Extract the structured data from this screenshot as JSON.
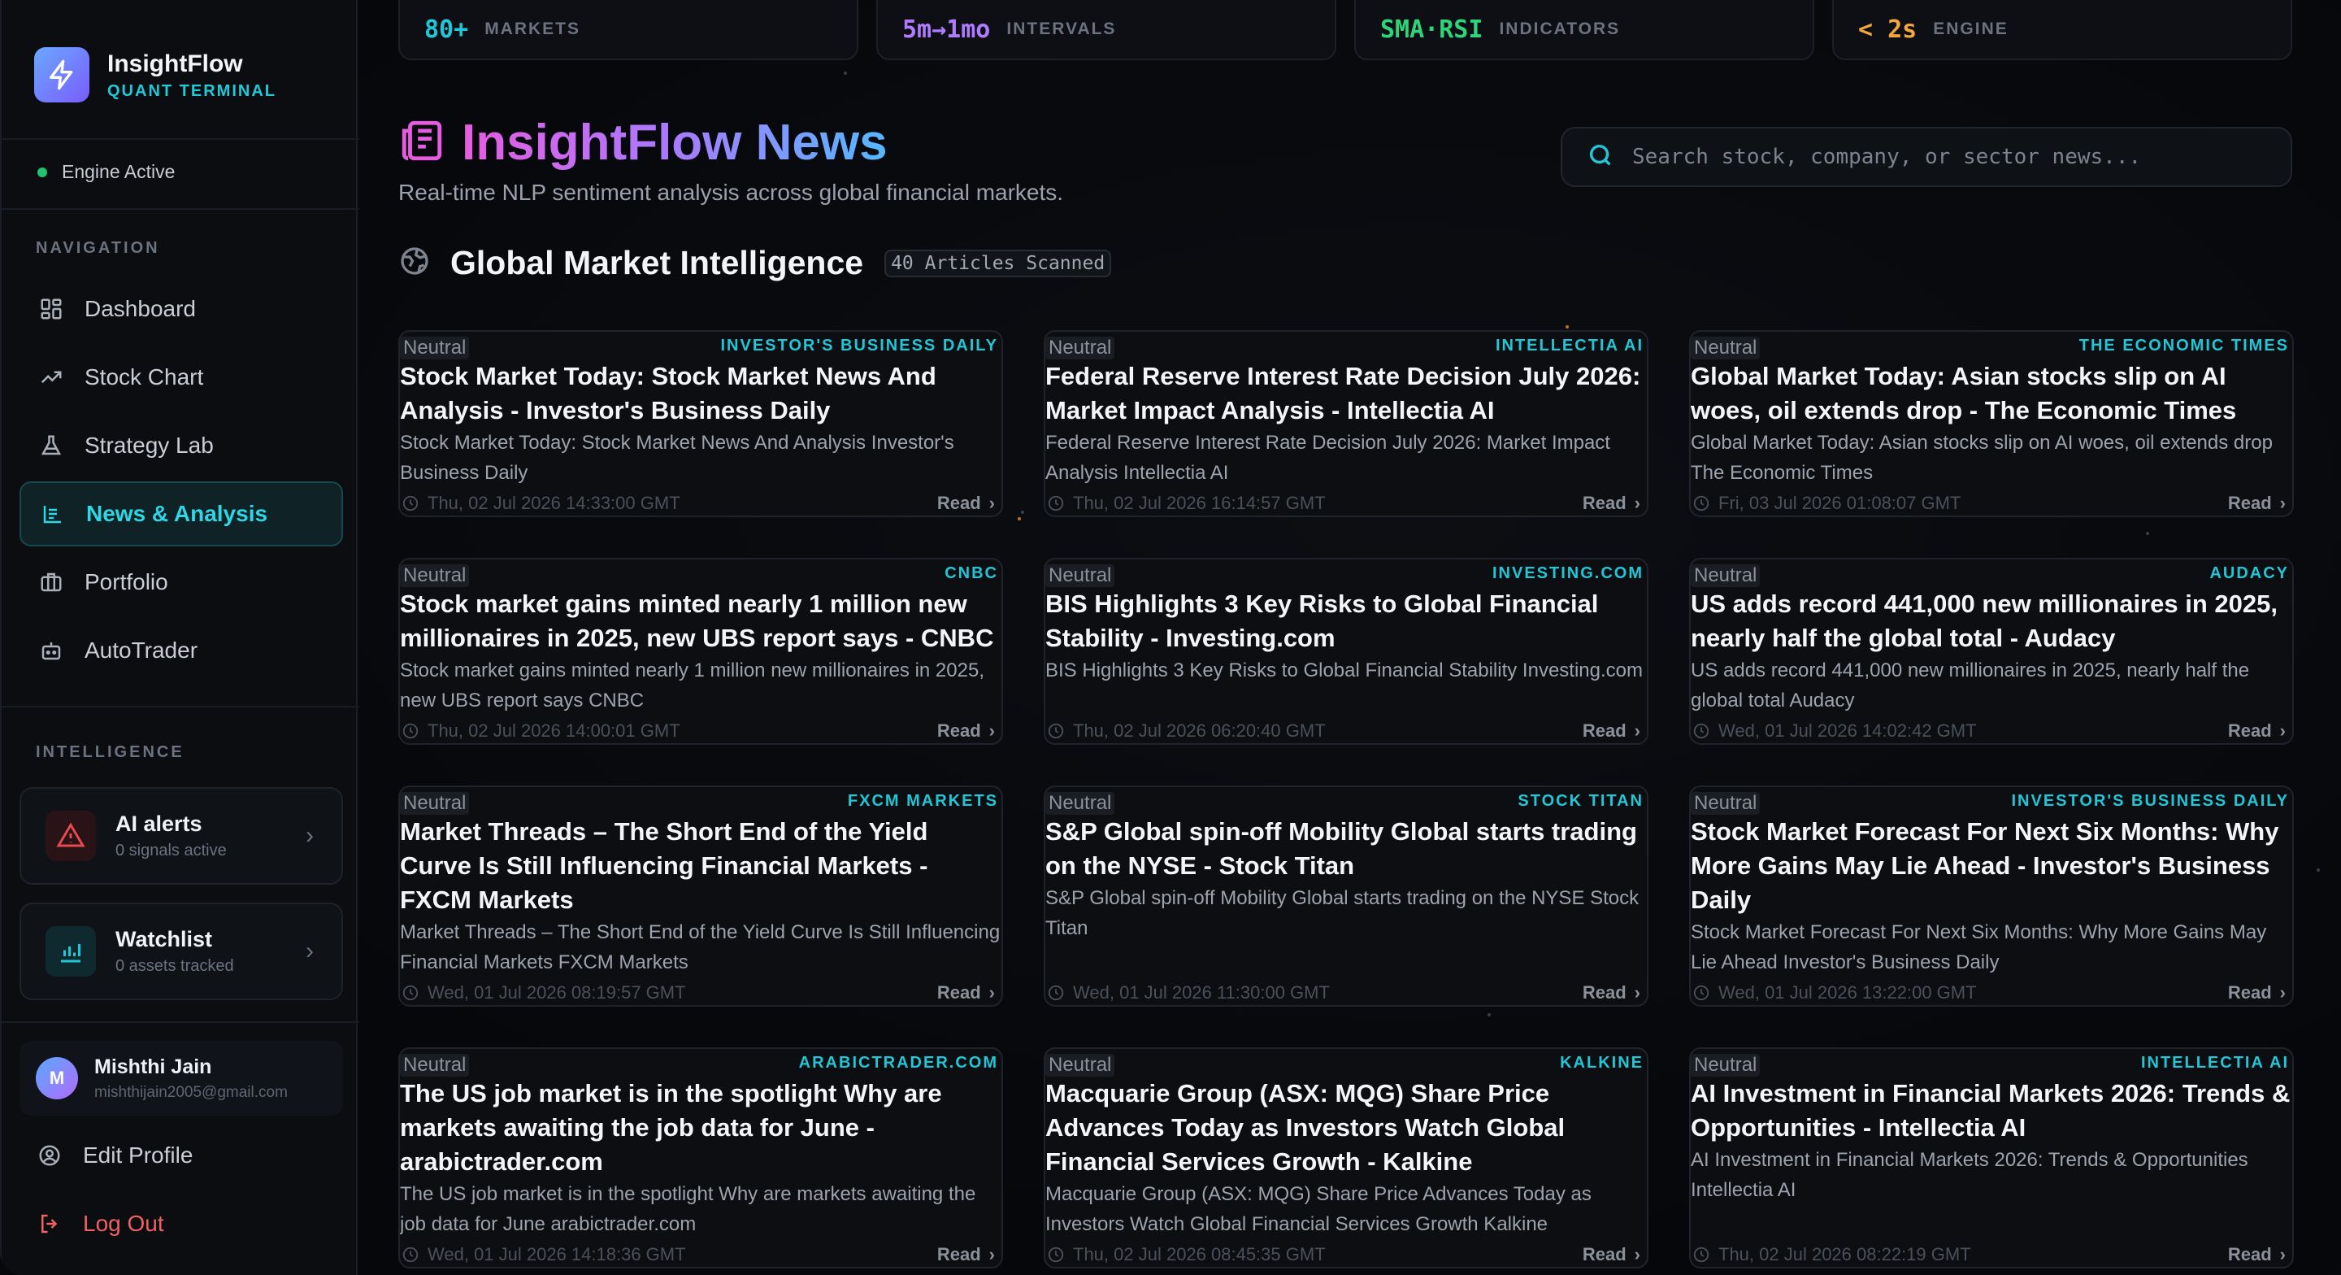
{
  "brand": {
    "name": "InsightFlow",
    "subtitle": "QUANT TERMINAL"
  },
  "engine_status": "Engine Active",
  "nav_label": "NAVIGATION",
  "nav": [
    {
      "label": "Dashboard",
      "icon": "grid-icon"
    },
    {
      "label": "Stock Chart",
      "icon": "trend-up-icon"
    },
    {
      "label": "Strategy Lab",
      "icon": "flask-icon"
    },
    {
      "label": "News & Analysis",
      "icon": "globe-news-icon",
      "active": true
    },
    {
      "label": "Portfolio",
      "icon": "briefcase-icon"
    },
    {
      "label": "AutoTrader",
      "icon": "robot-icon"
    }
  ],
  "intel_label": "INTELLIGENCE",
  "intel": [
    {
      "title": "AI alerts",
      "sub": "0 signals active",
      "icon": "alert-triangle-icon",
      "color": "#e5484d"
    },
    {
      "title": "Watchlist",
      "sub": "0 assets tracked",
      "icon": "bar-chart-icon",
      "color": "#21c7d6"
    }
  ],
  "user": {
    "initial": "M",
    "name": "Mishthi Jain",
    "email": "mishthijain2005@gmail.com"
  },
  "edit_profile": "Edit Profile",
  "log_out": "Log Out",
  "stats": [
    {
      "value": "80+",
      "label": "MARKETS",
      "color": "#21c7d6"
    },
    {
      "value": "5m→1mo",
      "label": "INTERVALS",
      "color": "#b07cff"
    },
    {
      "value": "SMA·RSI",
      "label": "INDICATORS",
      "color": "#2fd37a"
    },
    {
      "value": "< 2s",
      "label": "ENGINE",
      "color": "#f3a63a"
    }
  ],
  "page": {
    "title": "InsightFlow News",
    "subtitle": "Real-time NLP sentiment analysis across global financial markets."
  },
  "search": {
    "placeholder": "Search stock, company, or sector news..."
  },
  "section": {
    "title": "Global Market Intelligence",
    "badge": "40 Articles Scanned"
  },
  "read_label": "Read",
  "articles": [
    {
      "sentiment": "Neutral",
      "source": "INVESTOR'S BUSINESS DAILY",
      "title": "Stock Market Today: Stock Market News And Analysis - Investor's Business Daily",
      "desc": "Stock Market Today: Stock Market News And Analysis Investor's Business Daily",
      "date": "Thu, 02 Jul 2026 14:33:00 GMT"
    },
    {
      "sentiment": "Neutral",
      "source": "INTELLECTIA AI",
      "title": "Federal Reserve Interest Rate Decision July 2026: Market Impact Analysis - Intellectia AI",
      "desc": "Federal Reserve Interest Rate Decision July 2026: Market Impact Analysis Intellectia AI",
      "date": "Thu, 02 Jul 2026 16:14:57 GMT"
    },
    {
      "sentiment": "Neutral",
      "source": "THE ECONOMIC TIMES",
      "title": "Global Market Today: Asian stocks slip on AI woes, oil extends drop - The Economic Times",
      "desc": "Global Market Today: Asian stocks slip on AI woes, oil extends drop The Economic Times",
      "date": "Fri, 03 Jul 2026 01:08:07 GMT"
    },
    {
      "sentiment": "Neutral",
      "source": "CNBC",
      "title": "Stock market gains minted nearly 1 million new millionaires in 2025, new UBS report says - CNBC",
      "desc": "Stock market gains minted nearly 1 million new millionaires in 2025, new UBS report says CNBC",
      "date": "Thu, 02 Jul 2026 14:00:01 GMT"
    },
    {
      "sentiment": "Neutral",
      "source": "INVESTING.COM",
      "title": "BIS Highlights 3 Key Risks to Global Financial Stability - Investing.com",
      "desc": "BIS Highlights 3 Key Risks to Global Financial Stability Investing.com",
      "date": "Thu, 02 Jul 2026 06:20:40 GMT"
    },
    {
      "sentiment": "Neutral",
      "source": "AUDACY",
      "title": "US adds record 441,000 new millionaires in 2025, nearly half the global total - Audacy",
      "desc": "US adds record 441,000 new millionaires in 2025, nearly half the global total Audacy",
      "date": "Wed, 01 Jul 2026 14:02:42 GMT"
    },
    {
      "sentiment": "Neutral",
      "source": "FXCM MARKETS",
      "title": "Market Threads – The Short End of the Yield Curve Is Still Influencing Financial Markets - FXCM Markets",
      "desc": "Market Threads – The Short End of the Yield Curve Is Still Influencing Financial Markets FXCM Markets",
      "date": "Wed, 01 Jul 2026 08:19:57 GMT"
    },
    {
      "sentiment": "Neutral",
      "source": "STOCK TITAN",
      "title": "S&P Global spin-off Mobility Global starts trading on the NYSE - Stock Titan",
      "desc": "S&P Global spin-off Mobility Global starts trading on the NYSE Stock Titan",
      "date": "Wed, 01 Jul 2026 11:30:00 GMT"
    },
    {
      "sentiment": "Neutral",
      "source": "INVESTOR'S BUSINESS DAILY",
      "title": "Stock Market Forecast For Next Six Months: Why More Gains May Lie Ahead - Investor's Business Daily",
      "desc": "Stock Market Forecast For Next Six Months: Why More Gains May Lie Ahead Investor's Business Daily",
      "date": "Wed, 01 Jul 2026 13:22:00 GMT"
    },
    {
      "sentiment": "Neutral",
      "source": "ARABICTRADER.COM",
      "title": "The US job market is in the spotlight Why are markets awaiting the job data for June - arabictrader.com",
      "desc": "The US job market is in the spotlight Why are markets awaiting the job data for June arabictrader.com",
      "date": "Wed, 01 Jul 2026 14:18:36 GMT"
    },
    {
      "sentiment": "Neutral",
      "source": "KALKINE",
      "title": "Macquarie Group (ASX: MQG) Share Price Advances Today as Investors Watch Global Financial Services Growth - Kalkine",
      "desc": "Macquarie Group (ASX: MQG) Share Price Advances Today as Investors Watch Global Financial Services Growth Kalkine",
      "date": "Thu, 02 Jul 2026 08:45:35 GMT"
    },
    {
      "sentiment": "Neutral",
      "source": "INTELLECTIA AI",
      "title": "AI Investment in Financial Markets 2026: Trends & Opportunities - Intellectia AI",
      "desc": "AI Investment in Financial Markets 2026: Trends & Opportunities Intellectia AI",
      "date": "Thu, 02 Jul 2026 08:22:19 GMT"
    }
  ]
}
